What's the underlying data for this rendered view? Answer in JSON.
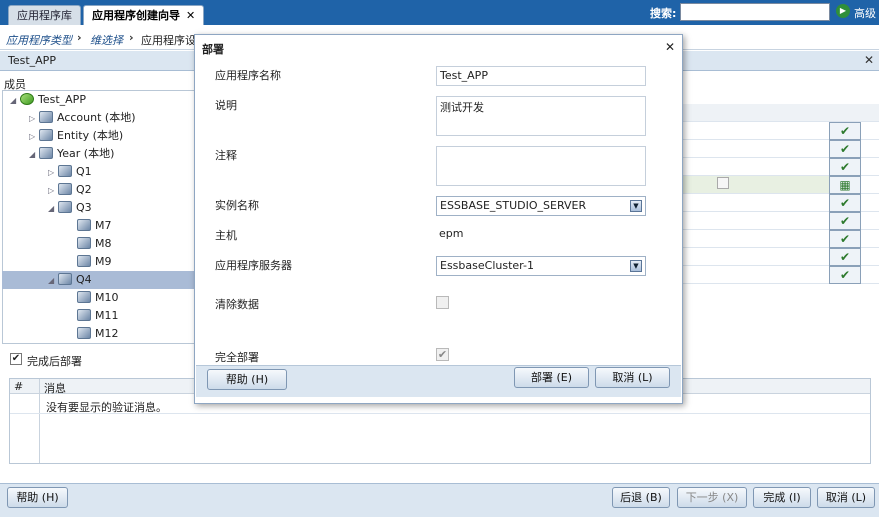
{
  "tabs": [
    {
      "label": "应用程序库"
    },
    {
      "label": "应用程序创建向导",
      "close": "✕"
    }
  ],
  "search": {
    "label": "搜索:",
    "value": "",
    "advanced": "高级"
  },
  "breadcrumb": {
    "items": [
      "应用程序类型",
      "维选择",
      "应用程序设置"
    ],
    "visible_last": "应用程序设"
  },
  "panel": {
    "title": "Test_APP",
    "close": "✕"
  },
  "members_label": "成员",
  "tree": [
    {
      "label": "Test_APP",
      "indent": 0,
      "toggle": "◢",
      "icon": "app-icon"
    },
    {
      "label": "Account (本地)",
      "indent": 1,
      "toggle": "▷",
      "icon": "account-dimension-icon"
    },
    {
      "label": "Entity (本地)",
      "indent": 1,
      "toggle": "▷",
      "icon": "entity-dimension-icon"
    },
    {
      "label": "Year (本地)",
      "indent": 1,
      "toggle": "◢",
      "icon": "year-dimension-icon"
    },
    {
      "label": "Q1",
      "indent": 2,
      "toggle": "▷",
      "icon": "member-icon"
    },
    {
      "label": "Q2",
      "indent": 2,
      "toggle": "▷",
      "icon": "member-icon"
    },
    {
      "label": "Q3",
      "indent": 2,
      "toggle": "◢",
      "icon": "member-icon"
    },
    {
      "label": "M7",
      "indent": 3,
      "toggle": "",
      "icon": "member-icon"
    },
    {
      "label": "M8",
      "indent": 3,
      "toggle": "",
      "icon": "member-icon"
    },
    {
      "label": "M9",
      "indent": 3,
      "toggle": "",
      "icon": "member-icon"
    },
    {
      "label": "Q4",
      "indent": 2,
      "toggle": "◢",
      "icon": "member-icon"
    },
    {
      "label": "M10",
      "indent": 3,
      "toggle": "",
      "icon": "member-icon"
    },
    {
      "label": "M11",
      "indent": 3,
      "toggle": "",
      "icon": "member-icon"
    },
    {
      "label": "M12",
      "indent": 3,
      "toggle": "",
      "icon": "member-icon"
    }
  ],
  "checkmarks": [
    "✔",
    "✔",
    "✔",
    "▦",
    "✔",
    "✔",
    "✔",
    "✔",
    "✔"
  ],
  "complete_after_deploy": {
    "label": "完成后部署",
    "checked": "✔"
  },
  "messages": {
    "columns": [
      "#",
      "消息"
    ],
    "rows": [
      {
        "num": "",
        "text": "没有要显示的验证消息。"
      }
    ]
  },
  "footer": {
    "help": "帮助 (H)",
    "back": "后退 (B)",
    "next": "下一步 (X)",
    "finish": "完成 (I)",
    "cancel": "取消 (L)"
  },
  "dialog": {
    "title": "部署",
    "close": "✕",
    "fields": {
      "app_name_label": "应用程序名称",
      "app_name_value": "Test_APP",
      "description_label": "说明",
      "description_value": "测试开发",
      "comment_label": "注释",
      "comment_value": "",
      "instance_label": "实例名称",
      "instance_value": "ESSBASE_STUDIO_SERVER",
      "host_label": "主机",
      "host_value": "epm",
      "app_server_label": "应用程序服务器",
      "app_server_value": "EssbaseCluster-1",
      "clear_data_label": "清除数据",
      "full_deploy_label": "完全部署",
      "full_deploy_checked": "✔"
    },
    "buttons": {
      "help": "帮助 (H)",
      "deploy": "部署 (E)",
      "cancel": "取消 (L)"
    }
  },
  "colors": {
    "topbar": "#1f63a8",
    "panel": "#dbe6f1",
    "selection": "#a9bbd6",
    "check": "#2d7a2d"
  }
}
